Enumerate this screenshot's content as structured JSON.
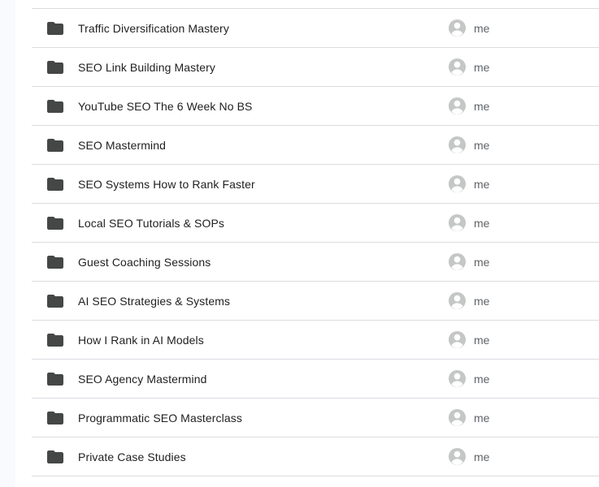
{
  "files": [
    {
      "name": "Traffic Diversification Mastery",
      "owner": "me",
      "icon": "folder-icon"
    },
    {
      "name": "SEO Link Building Mastery",
      "owner": "me",
      "icon": "folder-icon"
    },
    {
      "name": "YouTube SEO The 6 Week No BS",
      "owner": "me",
      "icon": "folder-icon"
    },
    {
      "name": "SEO Mastermind",
      "owner": "me",
      "icon": "folder-icon"
    },
    {
      "name": "SEO Systems How to Rank Faster",
      "owner": "me",
      "icon": "folder-icon"
    },
    {
      "name": "Local SEO Tutorials & SOPs",
      "owner": "me",
      "icon": "folder-icon"
    },
    {
      "name": "Guest Coaching Sessions",
      "owner": "me",
      "icon": "folder-icon"
    },
    {
      "name": "AI SEO Strategies & Systems",
      "owner": "me",
      "icon": "folder-icon"
    },
    {
      "name": "How I Rank in AI Models",
      "owner": "me",
      "icon": "folder-icon"
    },
    {
      "name": "SEO Agency Mastermind",
      "owner": "me",
      "icon": "folder-icon"
    },
    {
      "name": "Programmatic SEO Masterclass",
      "owner": "me",
      "icon": "folder-icon"
    },
    {
      "name": "Private Case Studies",
      "owner": "me",
      "icon": "folder-icon"
    }
  ],
  "colors": {
    "folder": "#444746",
    "avatar": "#c4c7c5",
    "divider": "#dadce0",
    "text": "#1f1f1f",
    "owner_text": "#5f6368",
    "rail": "#f8fafd"
  }
}
